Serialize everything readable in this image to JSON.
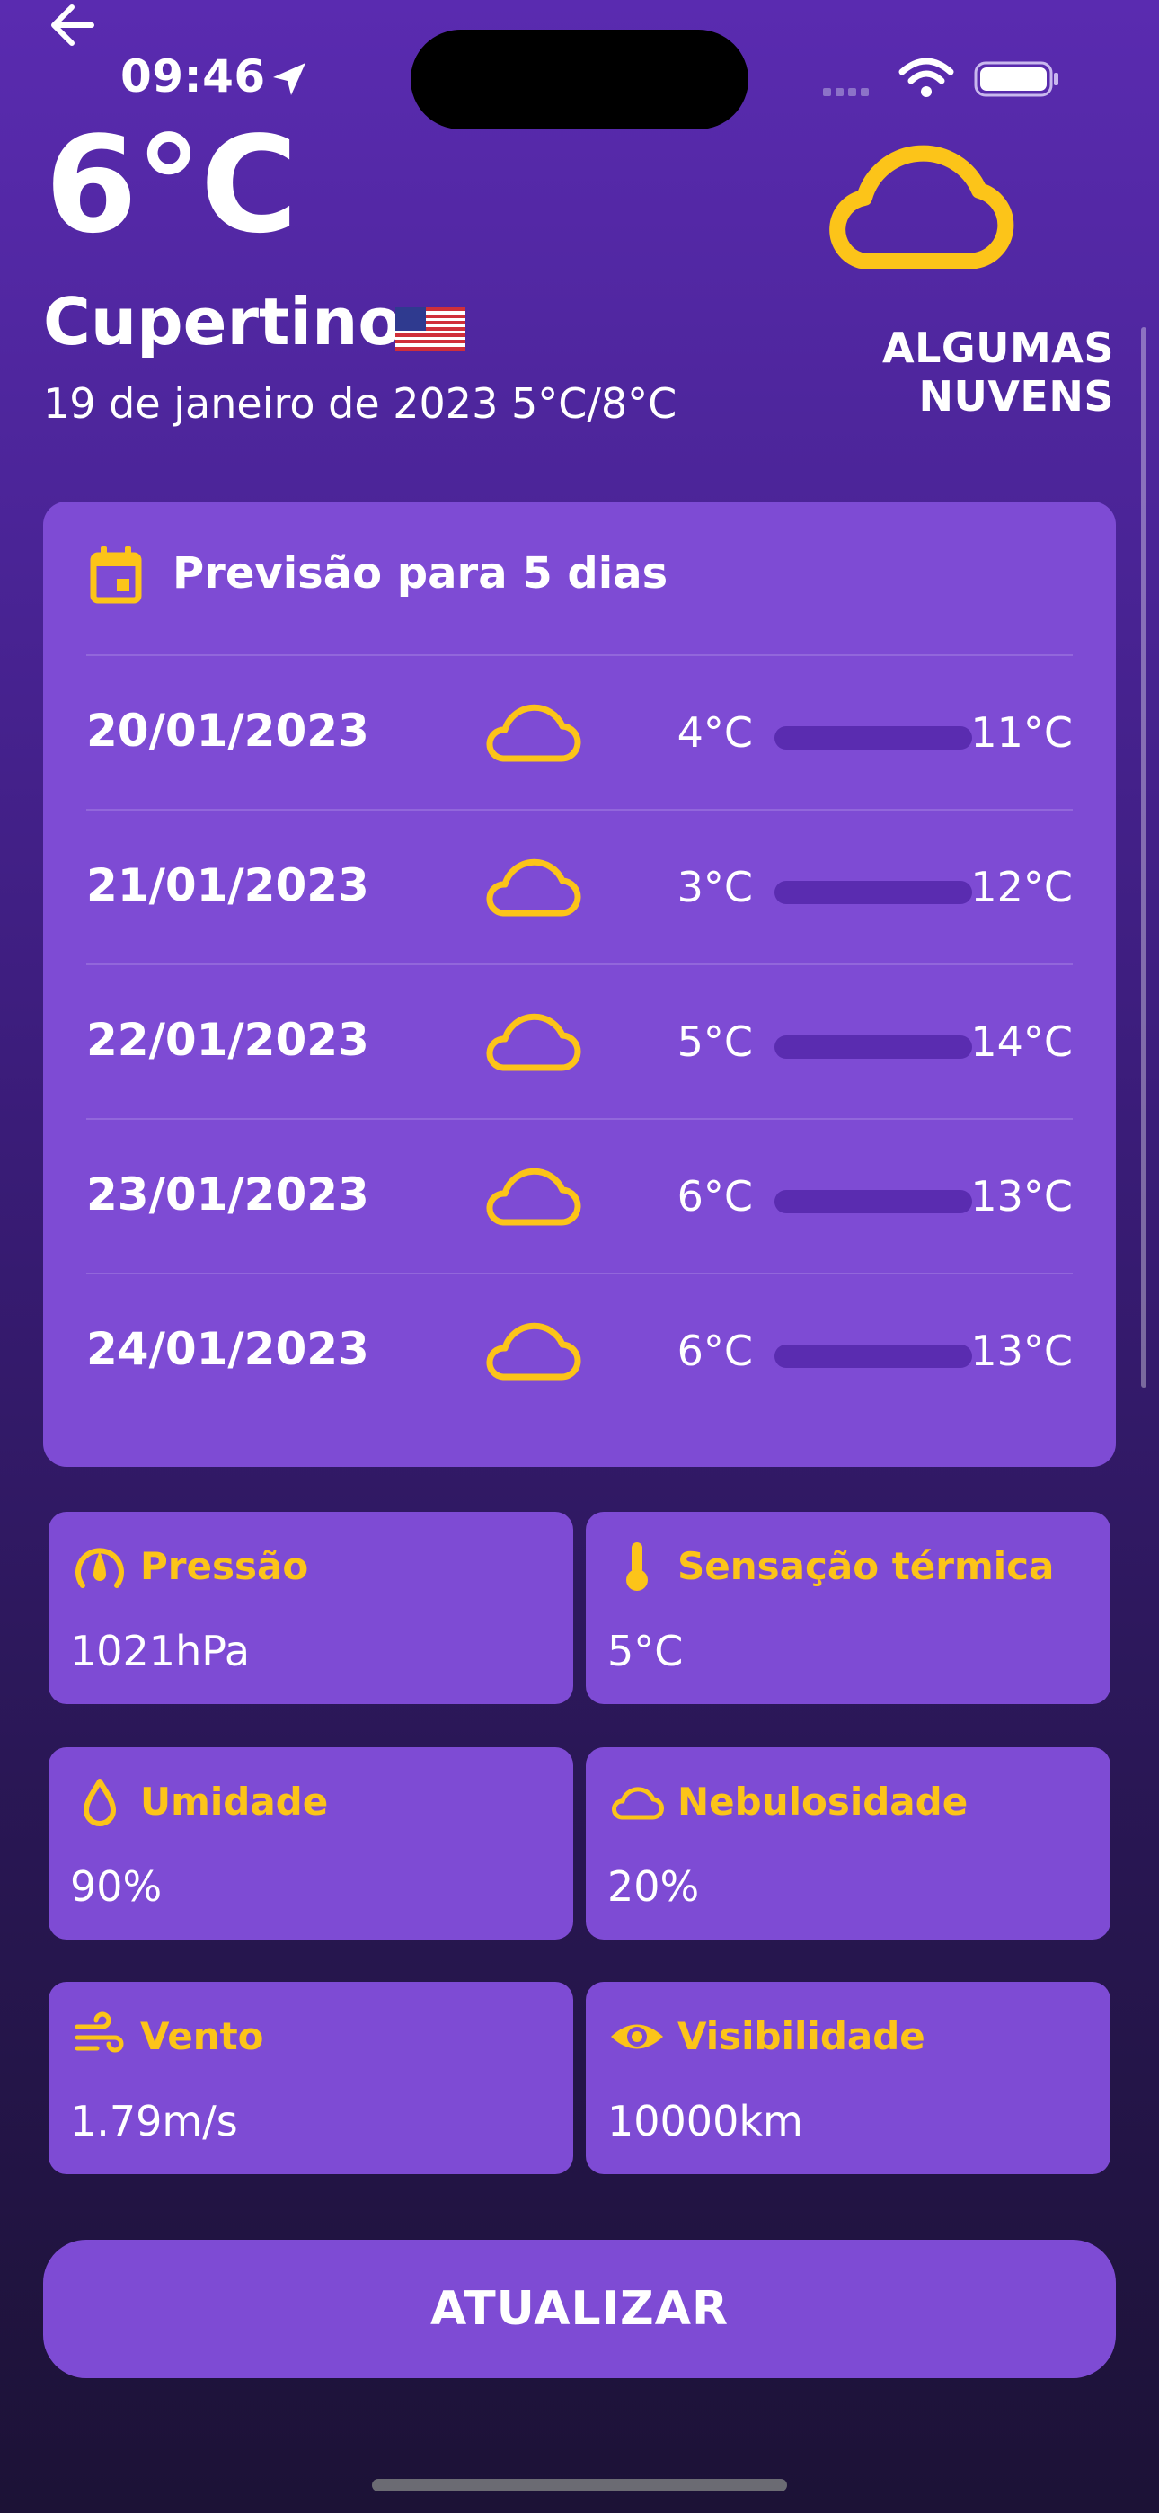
{
  "status_bar": {
    "time": "09:46"
  },
  "current": {
    "temperature": "6°C",
    "city": "Cupertino",
    "condition": "ALGUMAS NUVENS",
    "date_range": "19 de janeiro de 2023 5°C/8°C"
  },
  "forecast": {
    "title": "Previsão para 5 dias",
    "days": [
      {
        "date": "20/01/2023",
        "min": "4°C",
        "max": "11°C"
      },
      {
        "date": "21/01/2023",
        "min": "3°C",
        "max": "12°C"
      },
      {
        "date": "22/01/2023",
        "min": "5°C",
        "max": "14°C"
      },
      {
        "date": "23/01/2023",
        "min": "6°C",
        "max": "13°C"
      },
      {
        "date": "24/01/2023",
        "min": "6°C",
        "max": "13°C"
      }
    ]
  },
  "details": {
    "pressure": {
      "label": "Pressão",
      "value": "1021hPa",
      "icon": "gauge-icon"
    },
    "feels_like": {
      "label": "Sensação térmica",
      "value": "5°C",
      "icon": "thermometer-icon"
    },
    "humidity": {
      "label": "Umidade",
      "value": "90%",
      "icon": "drop-icon"
    },
    "cloudiness": {
      "label": "Nebulosidade",
      "value": "20%",
      "icon": "cloud-icon"
    },
    "wind": {
      "label": "Vento",
      "value": "1.79m/s",
      "icon": "wind-icon"
    },
    "visibility": {
      "label": "Visibilidade",
      "value": "10000km",
      "icon": "eye-icon"
    }
  },
  "actions": {
    "update_label": "ATUALIZAR"
  },
  "colors": {
    "accent": "#fcc419",
    "card": "#7e4bd4",
    "bar": "#5a2cb0"
  }
}
